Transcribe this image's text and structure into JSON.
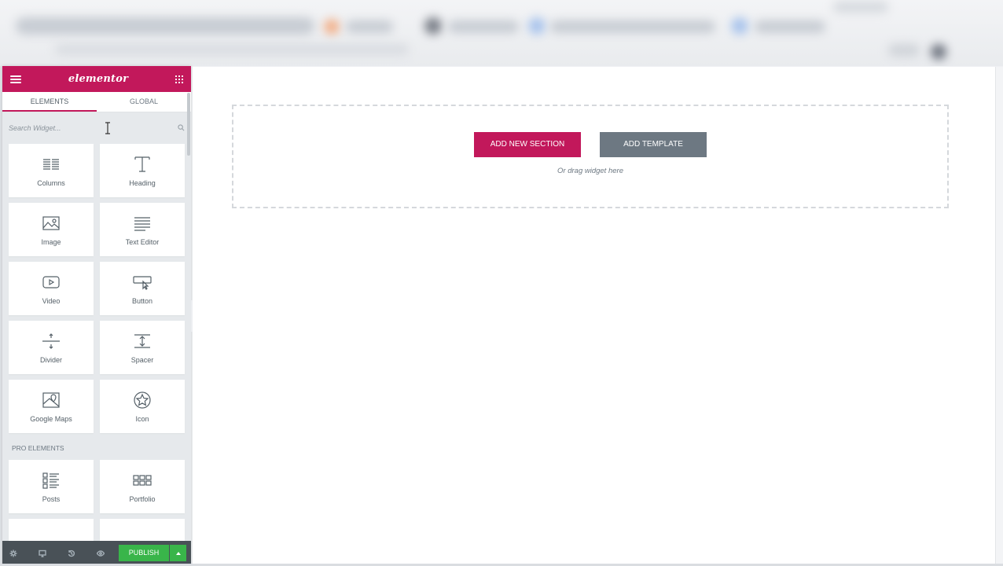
{
  "panel": {
    "logo_text": "elementor",
    "tabs": [
      {
        "label": "ELEMENTS",
        "active": true
      },
      {
        "label": "GLOBAL",
        "active": false
      }
    ],
    "search_placeholder": "Search Widget...",
    "widgets": [
      {
        "label": "Columns",
        "icon": "columns-icon"
      },
      {
        "label": "Heading",
        "icon": "heading-icon"
      },
      {
        "label": "Image",
        "icon": "image-icon"
      },
      {
        "label": "Text Editor",
        "icon": "text-editor-icon"
      },
      {
        "label": "Video",
        "icon": "video-icon"
      },
      {
        "label": "Button",
        "icon": "button-icon"
      },
      {
        "label": "Divider",
        "icon": "divider-icon"
      },
      {
        "label": "Spacer",
        "icon": "spacer-icon"
      },
      {
        "label": "Google Maps",
        "icon": "google-maps-icon"
      },
      {
        "label": "Icon",
        "icon": "star-icon"
      }
    ],
    "pro_section_title": "PRO ELEMENTS",
    "pro_widgets": [
      {
        "label": "Posts",
        "icon": "posts-icon"
      },
      {
        "label": "Portfolio",
        "icon": "portfolio-icon"
      }
    ],
    "footer": {
      "publish_label": "PUBLISH"
    }
  },
  "canvas": {
    "add_section_label": "ADD NEW SECTION",
    "add_template_label": "ADD TEMPLATE",
    "drag_hint": "Or drag widget here"
  },
  "colors": {
    "brand": "#c2185b",
    "publish": "#39b54a",
    "footer": "#495157",
    "secondary_button": "#6d7882"
  }
}
